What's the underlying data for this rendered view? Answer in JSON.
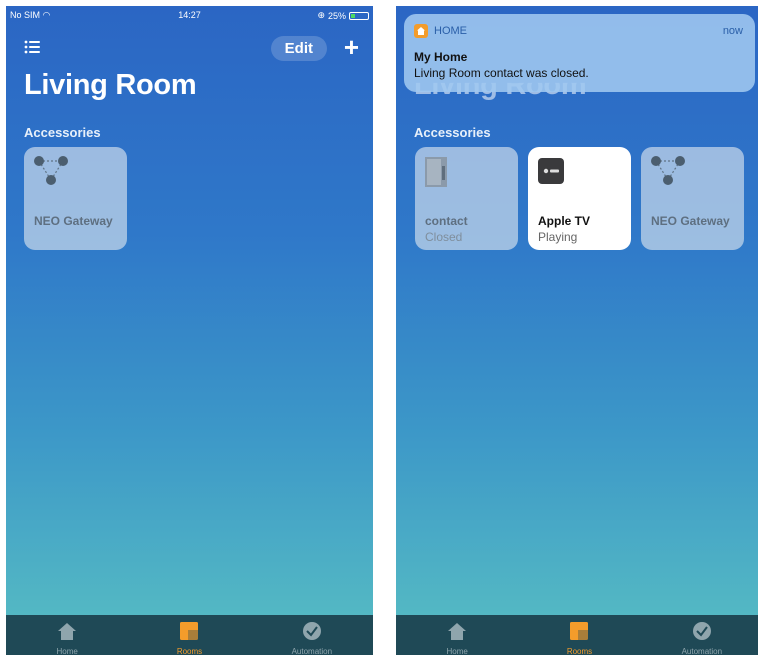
{
  "left": {
    "status": {
      "carrier": "No SIM",
      "time": "14:27",
      "battery": "25%"
    },
    "nav": {
      "edit_label": "Edit",
      "add_label": "+"
    },
    "room_title": "Living Room",
    "section_label": "Accessories",
    "tiles": [
      {
        "name": "NEO Gateway",
        "icon": "hub-icon"
      }
    ]
  },
  "right": {
    "notification": {
      "app": "HOME",
      "time": "now",
      "title": "My Home",
      "body": "Living Room contact was closed."
    },
    "room_title": "Living Room",
    "section_label": "Accessories",
    "tiles": [
      {
        "name": "contact",
        "state": "Closed",
        "icon": "door-sensor-icon"
      },
      {
        "name": "Apple TV",
        "state": "Playing",
        "icon": "apple-tv-icon"
      },
      {
        "name": "NEO Gateway",
        "icon": "hub-icon"
      }
    ]
  },
  "tabs": [
    {
      "label": "Home",
      "icon": "house-icon"
    },
    {
      "label": "Rooms",
      "icon": "rooms-icon"
    },
    {
      "label": "Automation",
      "icon": "clock-check-icon"
    }
  ],
  "colors": {
    "accent": "#f39c2b",
    "tab_bar": "#1f4956",
    "gradient_top": "#2b66c4",
    "gradient_bottom": "#58bfc3"
  }
}
